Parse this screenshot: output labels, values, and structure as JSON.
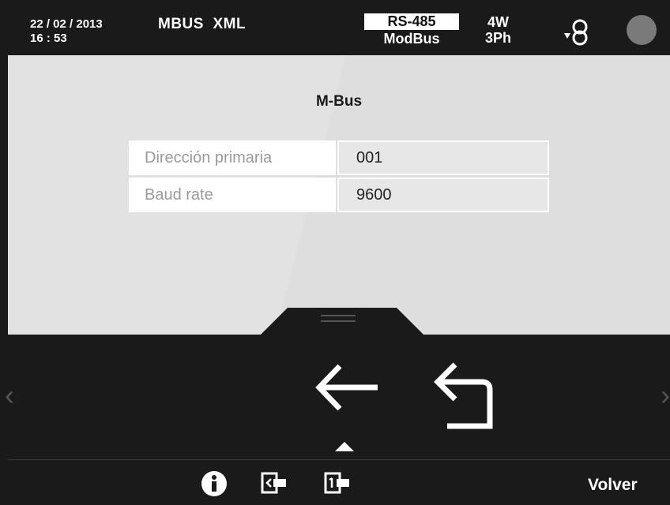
{
  "status": {
    "date": "22 / 02 / 2013",
    "time": "16 : 53",
    "protocol": "MBUS  XML",
    "comm_top": "RS-485",
    "comm_bottom": "ModBus",
    "wiring_top": "4W",
    "wiring_bottom": "3Ph",
    "indicator_color": "#7a7a7a"
  },
  "page": {
    "title": "M-Bus",
    "rows": [
      {
        "label": "Dirección primaria",
        "value": "001"
      },
      {
        "label": "Baud rate",
        "value": "9600"
      }
    ]
  },
  "nav": {
    "back_icon": "arrow-left-icon",
    "return_icon": "return-arrow-icon",
    "chevron_left": "‹",
    "chevron_right": "›"
  },
  "footer": {
    "icons": [
      "info-icon",
      "exit-icon",
      "first-page-icon"
    ],
    "back_label": "Volver"
  }
}
